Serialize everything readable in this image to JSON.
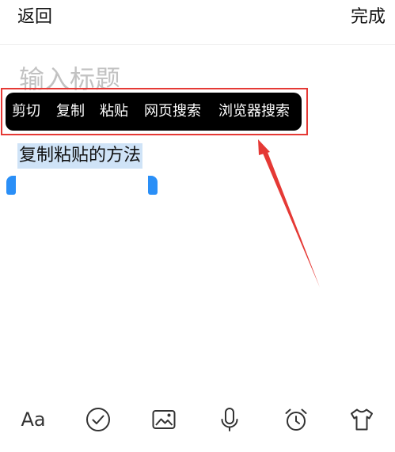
{
  "header": {
    "back_label": "返回",
    "done_label": "完成"
  },
  "editor": {
    "title_placeholder": "输入标题",
    "selected_text": "复制粘贴的方法"
  },
  "context_menu": {
    "items": [
      "剪切",
      "复制",
      "粘贴",
      "网页搜索",
      "浏览器搜索"
    ]
  },
  "toolbar": {
    "format_label": "Aa",
    "icons": [
      "check-icon",
      "image-icon",
      "microphone-icon",
      "alarm-clock-icon",
      "tshirt-icon"
    ]
  },
  "colors": {
    "highlight_box": "#e53935",
    "arrow": "#e53935",
    "selection": "#cfe3f7",
    "handle": "#2a8ff7",
    "menu_bg": "#000000"
  }
}
